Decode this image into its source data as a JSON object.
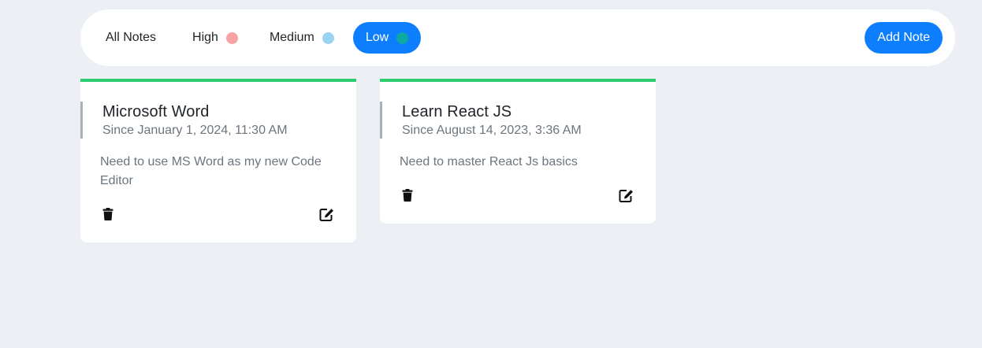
{
  "filters": {
    "all_label": "All Notes",
    "high_label": "High",
    "medium_label": "Medium",
    "low_label": "Low",
    "active": "Low",
    "colors": {
      "high": "#f7a3a3",
      "medium": "#99d3f2",
      "low": "#0ea9a2",
      "active_bg": "#0d7efd"
    }
  },
  "toolbar": {
    "add_note_label": "Add Note"
  },
  "notes": [
    {
      "title": "Microsoft Word",
      "date": "Since January 1, 2024, 11:30 AM",
      "body": "Need to use MS Word as my new Code Editor",
      "accent": "#2ecc71",
      "delete_icon": "trash-icon",
      "edit_icon": "edit-icon"
    },
    {
      "title": "Learn React JS",
      "date": "Since August 14, 2023, 3:36 AM",
      "body": "Need to master React Js basics",
      "accent": "#2ecc71",
      "delete_icon": "trash-icon",
      "edit_icon": "edit-icon"
    }
  ]
}
